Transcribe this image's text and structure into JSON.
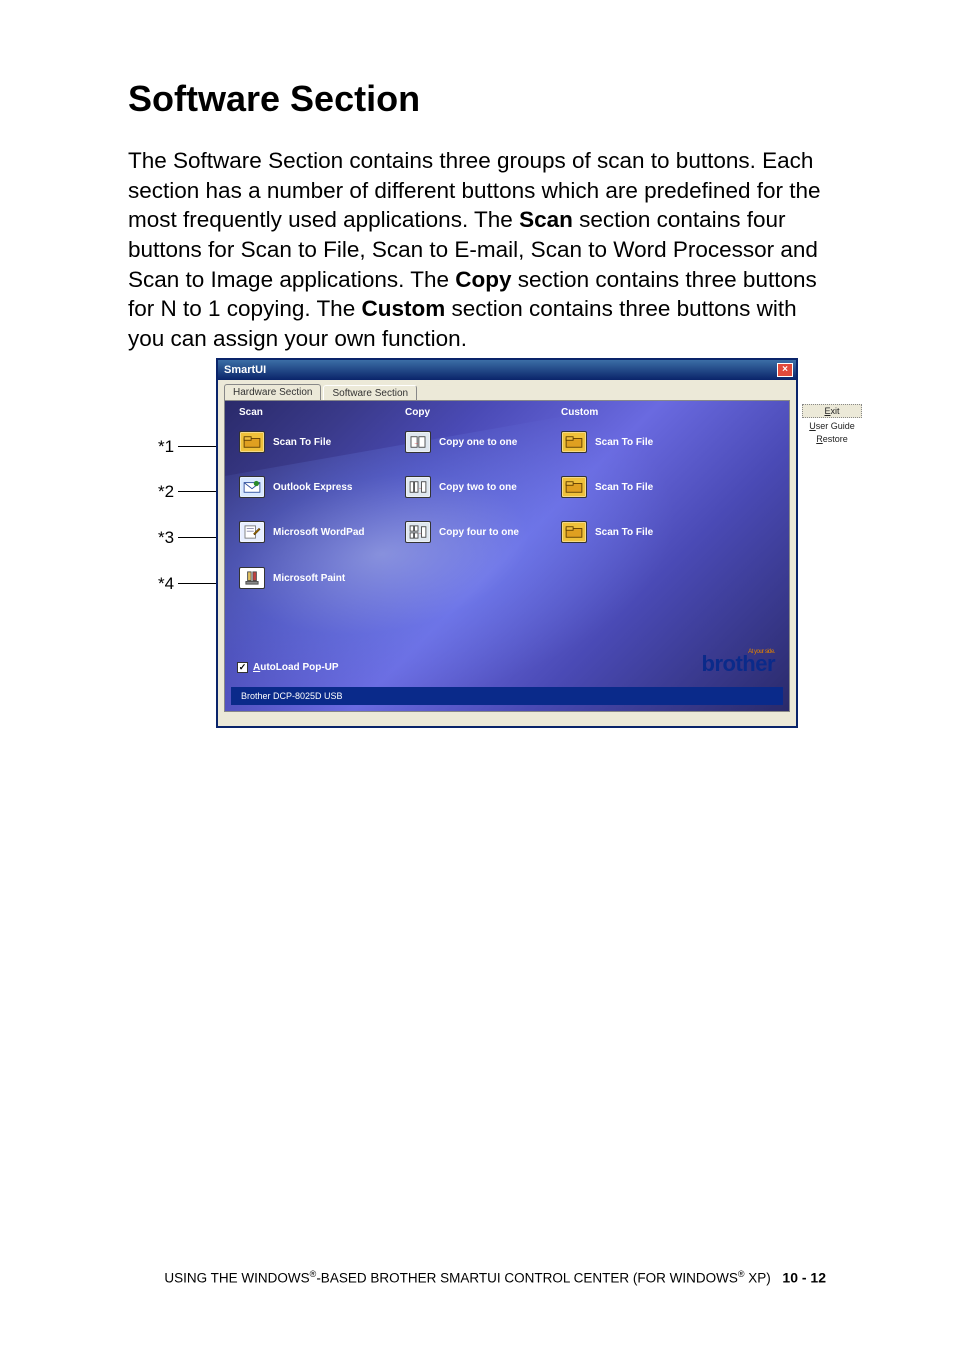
{
  "heading": "Software Section",
  "body": {
    "p1a": "The Software Section contains three groups of scan to buttons. Each section has a number of different buttons which are predefined for the most frequently used applications. The ",
    "scan_b": "Scan",
    "p1b": " section contains four buttons for Scan to File, Scan to E-mail, Scan to Word Processor and Scan to Image applications. The ",
    "copy_b": "Copy",
    "p1c": " section contains three buttons for N to 1 copying. The ",
    "custom_b": "Custom",
    "p1d": " section contains three buttons with you can assign your own function."
  },
  "callouts": {
    "c1": "*1",
    "c2": "*2",
    "c3": "*3",
    "c4": "*4"
  },
  "window": {
    "title": "SmartUI",
    "tabs": {
      "hw": "Hardware Section",
      "sw": "Software Section"
    },
    "columns": {
      "scan": "Scan",
      "copy": "Copy",
      "custom": "Custom"
    },
    "scan": {
      "r1": "Scan To File",
      "r2": "Outlook Express",
      "r3": "Microsoft WordPad",
      "r4": "Microsoft Paint"
    },
    "copy": {
      "r1": "Copy one to one",
      "r2": "Copy two to one",
      "r3": "Copy four to one"
    },
    "custom": {
      "r1": "Scan To File",
      "r2": "Scan To File",
      "r3": "Scan To File"
    },
    "autoload": {
      "check": "✓",
      "label_u": "A",
      "label_rest": "utoLoad Pop-UP"
    },
    "logo": {
      "side": "At your side.",
      "name": "brother"
    },
    "status": "Brother DCP-8025D USB",
    "side": {
      "exit_u": "E",
      "exit_rest": "xit",
      "ug_u": "U",
      "ug_rest": "ser Guide",
      "restore_u": "R",
      "restore_rest": "estore"
    }
  },
  "footer": {
    "text_a": "USING THE WINDOWS",
    "reg": "®",
    "text_b": "-BASED BROTHER SMARTUI CONTROL CENTER (FOR WINDOWS",
    "text_c": " XP)",
    "page": "10 - 12"
  }
}
